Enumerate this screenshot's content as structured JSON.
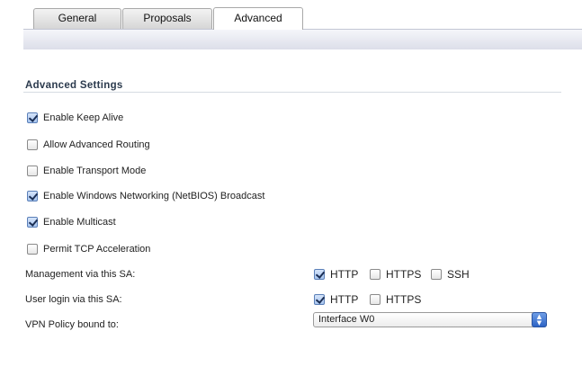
{
  "tabs": [
    {
      "label": "General"
    },
    {
      "label": "Proposals"
    },
    {
      "label": "Advanced",
      "active": true
    }
  ],
  "section_title": "Advanced Settings",
  "checkboxes": [
    {
      "label": "Enable Keep Alive",
      "checked": true
    },
    {
      "label": "Allow Advanced Routing",
      "checked": false
    },
    {
      "label": "Enable Transport Mode",
      "checked": false
    },
    {
      "label": "Enable Windows Networking (NetBIOS) Broadcast",
      "checked": true
    },
    {
      "label": "Enable Multicast",
      "checked": true
    },
    {
      "label": "Permit TCP Acceleration",
      "checked": false
    }
  ],
  "management": {
    "label": "Management via this SA:",
    "options": [
      {
        "label": "HTTP",
        "checked": true
      },
      {
        "label": "HTTPS",
        "checked": false
      },
      {
        "label": "SSH",
        "checked": false
      }
    ]
  },
  "user_login": {
    "label": "User login via this SA:",
    "options": [
      {
        "label": "HTTP",
        "checked": true
      },
      {
        "label": "HTTPS",
        "checked": false
      }
    ]
  },
  "vpn_policy": {
    "label": "VPN Policy bound to:",
    "selected": "Interface W0",
    "arrow_icon": "updown-arrows-icon"
  }
}
